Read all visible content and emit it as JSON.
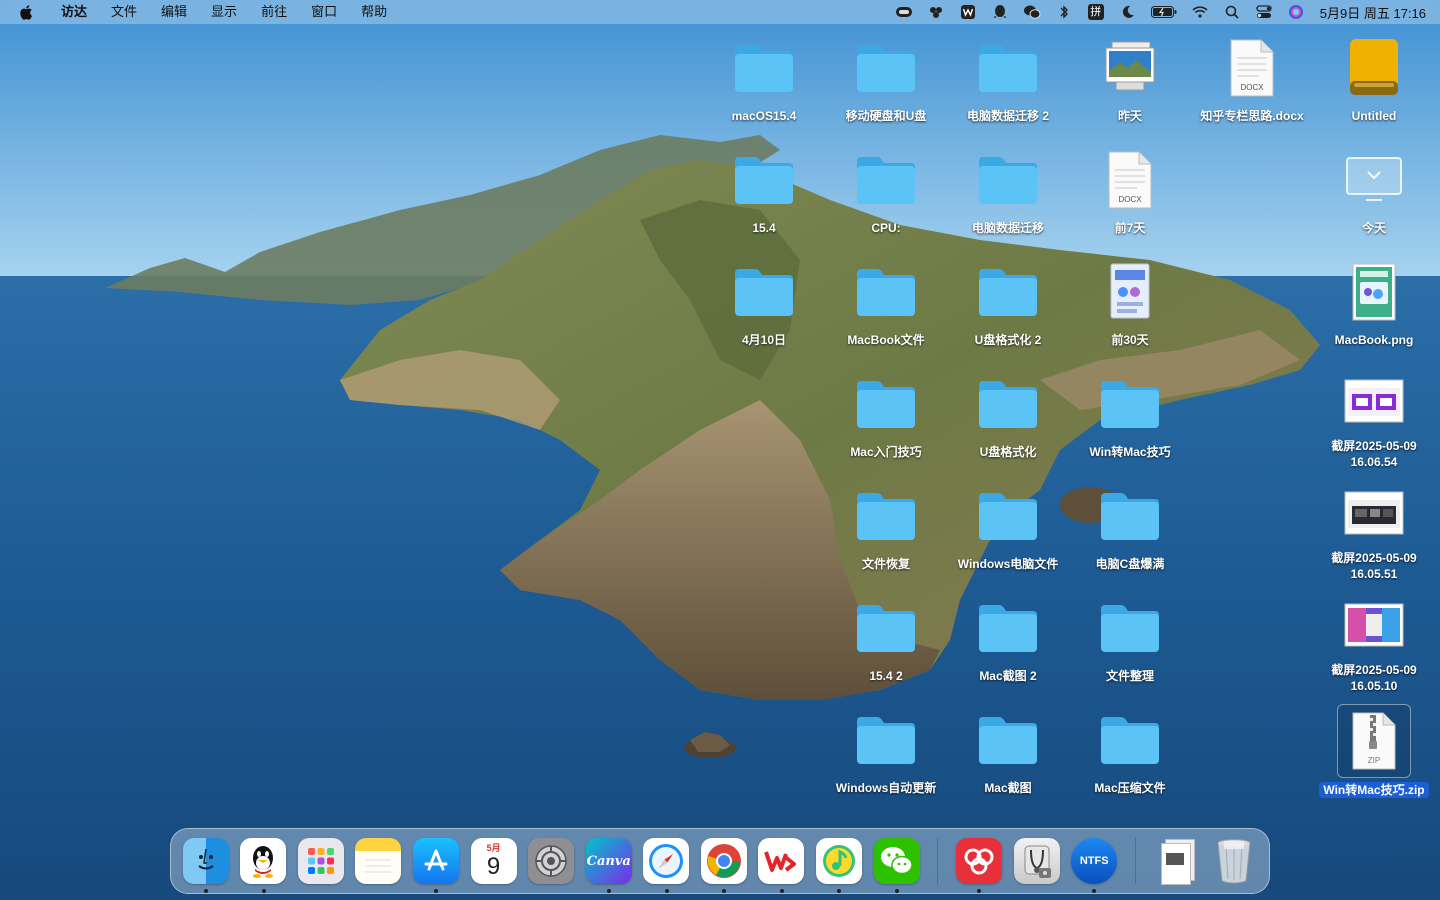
{
  "menubar": {
    "items": [
      "访达",
      "文件",
      "编辑",
      "显示",
      "前往",
      "窗口",
      "帮助"
    ],
    "status_icons": [
      "ntfs-icon",
      "baidu-netdisk-icon",
      "wps-icon",
      "qq-icon",
      "wechat-icon",
      "bluetooth-icon",
      "input-method-icon",
      "focus-moon-icon",
      "battery-icon",
      "wifi-icon",
      "spotlight-icon",
      "control-center-icon",
      "siri-icon"
    ],
    "input_method_label": "拼",
    "clock": "5月9日 周五 17:16"
  },
  "desktop": {
    "icons": [
      {
        "label": "macOS15.4",
        "kind": "folder"
      },
      {
        "label": "移动硬盘和U盘",
        "kind": "folder"
      },
      {
        "label": "电脑数据迁移 2",
        "kind": "folder"
      },
      {
        "label": "昨天",
        "kind": "stack-image"
      },
      {
        "label": "知乎专栏思路.docx",
        "kind": "docx"
      },
      {
        "label": "Untitled",
        "kind": "drive"
      },
      {
        "label": "15.4",
        "kind": "folder"
      },
      {
        "label": "CPU:",
        "kind": "folder"
      },
      {
        "label": "电脑数据迁移",
        "kind": "folder"
      },
      {
        "label": "前7天",
        "kind": "docx"
      },
      {
        "label": "今天",
        "kind": "screen"
      },
      {
        "label": "4月10日",
        "kind": "folder"
      },
      {
        "label": "MacBook文件",
        "kind": "folder"
      },
      {
        "label": "U盘格式化 2",
        "kind": "folder"
      },
      {
        "label": "前30天",
        "kind": "stack-app"
      },
      {
        "label": "MacBook.png",
        "kind": "png"
      },
      {
        "label": "Mac入门技巧",
        "kind": "folder"
      },
      {
        "label": "U盘格式化",
        "kind": "folder"
      },
      {
        "label": "Win转Mac技巧",
        "kind": "folder"
      },
      {
        "label": "截屏2025-05-09\n16.06.54",
        "kind": "screenshot-purple"
      },
      {
        "label": "文件恢复",
        "kind": "folder"
      },
      {
        "label": "Windows电脑文件",
        "kind": "folder"
      },
      {
        "label": "电脑C盘爆满",
        "kind": "folder"
      },
      {
        "label": "截屏2025-05-09\n16.05.51",
        "kind": "screenshot-dark"
      },
      {
        "label": "15.4 2",
        "kind": "folder"
      },
      {
        "label": "Mac截图 2",
        "kind": "folder"
      },
      {
        "label": "文件整理",
        "kind": "folder"
      },
      {
        "label": "截屏2025-05-09\n16.05.10",
        "kind": "screenshot-colorful"
      },
      {
        "label": "Windows自动更新",
        "kind": "folder"
      },
      {
        "label": "Mac截图",
        "kind": "folder"
      },
      {
        "label": "Mac压缩文件",
        "kind": "folder"
      },
      {
        "label": "Win转Mac技巧.zip",
        "kind": "zip"
      }
    ],
    "docx_tag": "DOCX",
    "zip_tag": "ZIP"
  },
  "dock": {
    "apps": [
      {
        "name": "finder-icon",
        "running": true
      },
      {
        "name": "qq-icon",
        "running": true
      },
      {
        "name": "launchpad-icon",
        "running": false
      },
      {
        "name": "notes-icon",
        "running": false
      },
      {
        "name": "app-store-icon",
        "running": true
      },
      {
        "name": "calendar-icon",
        "running": false
      },
      {
        "name": "system-settings-icon",
        "running": false
      },
      {
        "name": "canva-icon",
        "running": true
      },
      {
        "name": "safari-icon",
        "running": true
      },
      {
        "name": "chrome-icon",
        "running": true
      },
      {
        "name": "wps-icon",
        "running": true
      },
      {
        "name": "qq-music-icon",
        "running": true
      },
      {
        "name": "wechat-icon",
        "running": true
      },
      {
        "name": "baidu-netdisk-icon",
        "running": true
      },
      {
        "name": "disk-utility-icon",
        "running": false
      },
      {
        "name": "ntfs-icon",
        "running": true
      },
      {
        "name": "document-stack-icon",
        "running": false
      },
      {
        "name": "trash-icon",
        "running": false
      }
    ],
    "calendar_month": "5月",
    "calendar_day": "9",
    "canva_label": "Canva",
    "ntfs_label": "NTFS"
  },
  "colors": {
    "folder": "#5bc3f5",
    "folder_top": "#3aa9e6",
    "selection": "#1a5fd6"
  }
}
